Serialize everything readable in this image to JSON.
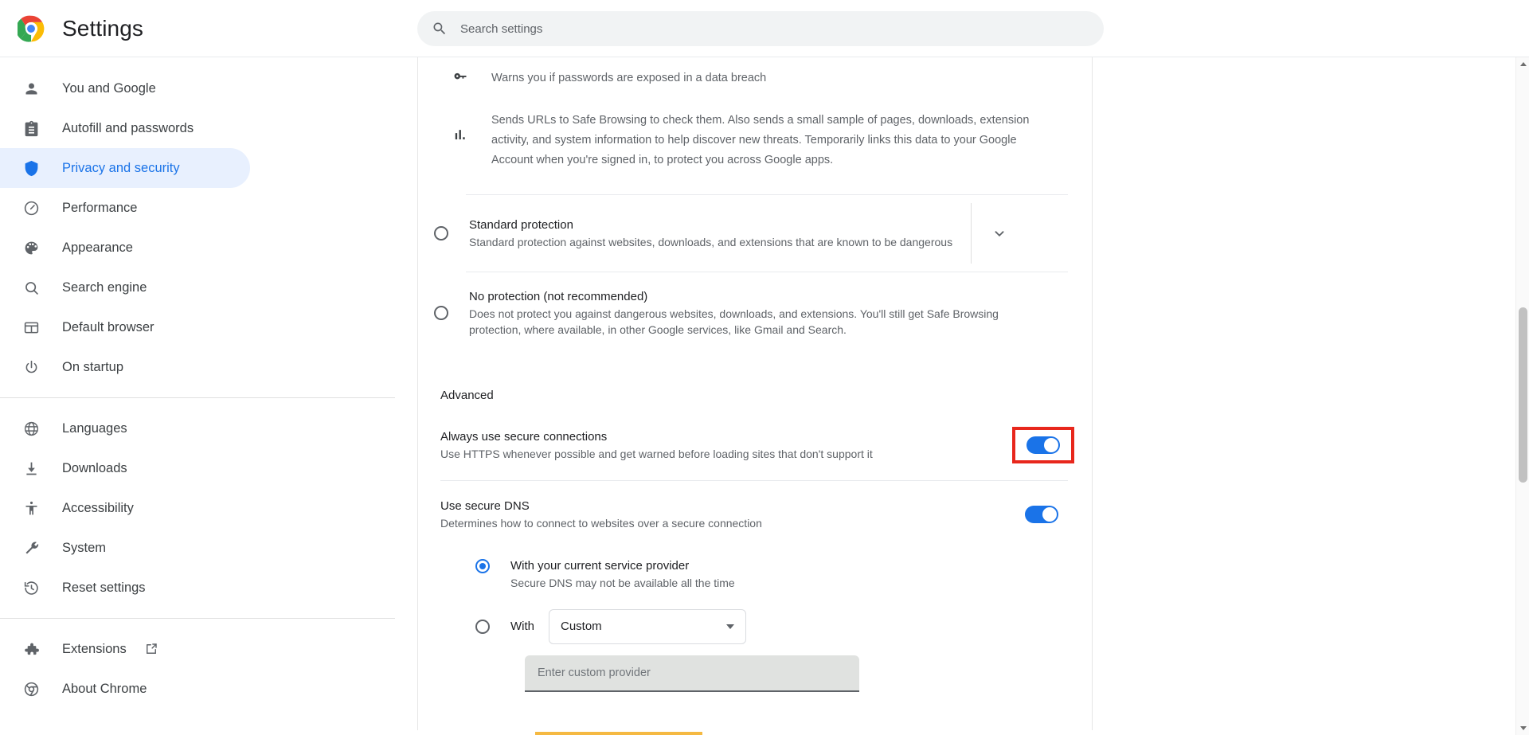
{
  "header": {
    "title": "Settings",
    "logo_icon": "chrome-logo",
    "search": {
      "icon": "search-icon",
      "placeholder": "Search settings",
      "value": ""
    }
  },
  "sidebar": {
    "groups": [
      {
        "items": [
          {
            "label": "You and Google",
            "icon": "person-icon",
            "active": false
          },
          {
            "label": "Autofill and passwords",
            "icon": "clipboard-icon",
            "active": false
          },
          {
            "label": "Privacy and security",
            "icon": "shield-icon",
            "active": true
          },
          {
            "label": "Performance",
            "icon": "speedometer-icon",
            "active": false
          },
          {
            "label": "Appearance",
            "icon": "palette-icon",
            "active": false
          },
          {
            "label": "Search engine",
            "icon": "search-icon",
            "active": false
          },
          {
            "label": "Default browser",
            "icon": "browser-window-icon",
            "active": false
          },
          {
            "label": "On startup",
            "icon": "power-icon",
            "active": false
          }
        ]
      },
      {
        "items": [
          {
            "label": "Languages",
            "icon": "globe-icon",
            "active": false
          },
          {
            "label": "Downloads",
            "icon": "download-icon",
            "active": false
          },
          {
            "label": "Accessibility",
            "icon": "accessibility-icon",
            "active": false
          },
          {
            "label": "System",
            "icon": "wrench-icon",
            "active": false
          },
          {
            "label": "Reset settings",
            "icon": "history-icon",
            "active": false
          }
        ]
      },
      {
        "items": [
          {
            "label": "Extensions",
            "icon": "puzzle-icon",
            "active": false,
            "external": true,
            "external_icon": "open-in-new-icon"
          },
          {
            "label": "About Chrome",
            "icon": "chrome-icon",
            "active": false,
            "external": false
          }
        ]
      }
    ]
  },
  "main": {
    "feature_rows": [
      {
        "icon": "key-icon",
        "text": "Warns you if passwords are exposed in a data breach"
      },
      {
        "icon": "bar-chart-icon",
        "text": "Sends URLs to Safe Browsing to check them. Also sends a small sample of pages, downloads, extension activity, and system information to help discover new threats. Temporarily links this data to your Google Account when you're signed in, to protect you across Google apps."
      }
    ],
    "protection_options": [
      {
        "title": "Standard protection",
        "description": "Standard protection against websites, downloads, and extensions that are known to be dangerous",
        "selected": false,
        "has_expand": true,
        "expand_icon": "chevron-down-icon"
      },
      {
        "title": "No protection (not recommended)",
        "description": "Does not protect you against dangerous websites, downloads, and extensions. You'll still get Safe Browsing protection, where available, in other Google services, like Gmail and Search.",
        "selected": false,
        "has_expand": false
      }
    ],
    "advanced": {
      "heading": "Advanced",
      "settings": [
        {
          "title": "Always use secure connections",
          "description": "Use HTTPS whenever possible and get warned before loading sites that don't support it",
          "toggle_on": true,
          "highlighted": true
        },
        {
          "title": "Use secure DNS",
          "description": "Determines how to connect to websites over a secure connection",
          "toggle_on": true,
          "highlighted": false
        }
      ],
      "dns_options": [
        {
          "label": "With your current service provider",
          "sublabel": "Secure DNS may not be available all the time",
          "selected": true
        },
        {
          "label": "With",
          "selected": false,
          "select_value": "Custom",
          "select_icon": "dropdown-caret-icon",
          "custom_input_placeholder": "Enter custom provider",
          "custom_input_value": ""
        }
      ]
    }
  },
  "scrollbar": {
    "up_icon": "scroll-up-arrow-icon",
    "down_icon": "scroll-down-arrow-icon"
  },
  "colors": {
    "accent": "#1a73e8",
    "active_bg": "#e8f0fe",
    "highlight_border": "#e8271c",
    "text_primary": "#202124",
    "text_secondary": "#5f6368"
  }
}
